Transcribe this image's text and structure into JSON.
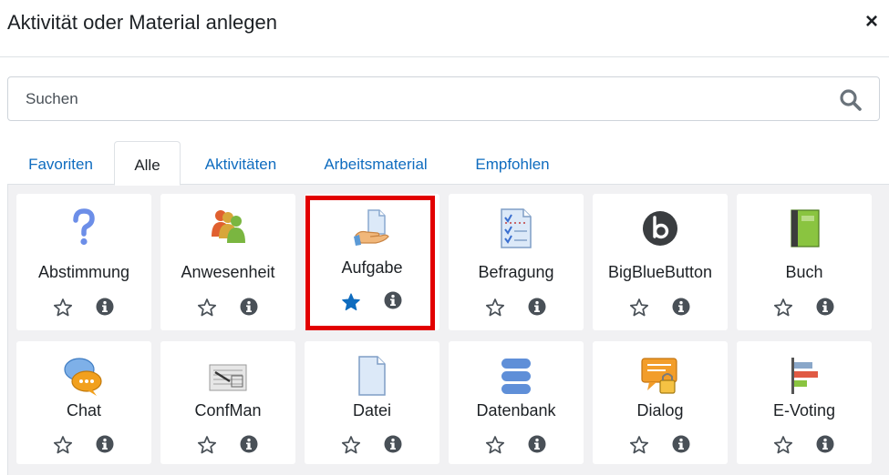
{
  "dialog": {
    "title": "Aktivität oder Material anlegen",
    "close_symbol": "×"
  },
  "search": {
    "placeholder": "Suchen",
    "value": ""
  },
  "tabs": [
    {
      "label": "Favoriten",
      "active": false
    },
    {
      "label": "Alle",
      "active": true
    },
    {
      "label": "Aktivitäten",
      "active": false
    },
    {
      "label": "Arbeitsmaterial",
      "active": false
    },
    {
      "label": "Empfohlen",
      "active": false
    }
  ],
  "modules": [
    {
      "label": "Abstimmung",
      "icon": "question-mark-icon",
      "starred": false
    },
    {
      "label": "Anwesenheit",
      "icon": "people-group-icon",
      "starred": false
    },
    {
      "label": "Aufgabe",
      "icon": "hand-document-icon",
      "starred": true,
      "highlighted": true
    },
    {
      "label": "Befragung",
      "icon": "checklist-document-icon",
      "starred": false
    },
    {
      "label": "BigBlueButton",
      "icon": "bigbluebutton-logo-icon",
      "starred": false
    },
    {
      "label": "Buch",
      "icon": "green-book-icon",
      "starred": false
    },
    {
      "label": "Chat",
      "icon": "chat-bubbles-icon",
      "starred": false
    },
    {
      "label": "ConfMan",
      "icon": "document-scan-icon",
      "starred": false
    },
    {
      "label": "Datei",
      "icon": "file-icon",
      "starred": false
    },
    {
      "label": "Datenbank",
      "icon": "database-icon",
      "starred": false
    },
    {
      "label": "Dialog",
      "icon": "locked-speech-bubble-icon",
      "starred": false
    },
    {
      "label": "E-Voting",
      "icon": "bar-chart-icon",
      "starred": false
    }
  ],
  "colors": {
    "link": "#0f6cbf",
    "star_active": "#0f6cbf",
    "highlight": "#e20000",
    "grid_background": "#f1f1f3"
  }
}
